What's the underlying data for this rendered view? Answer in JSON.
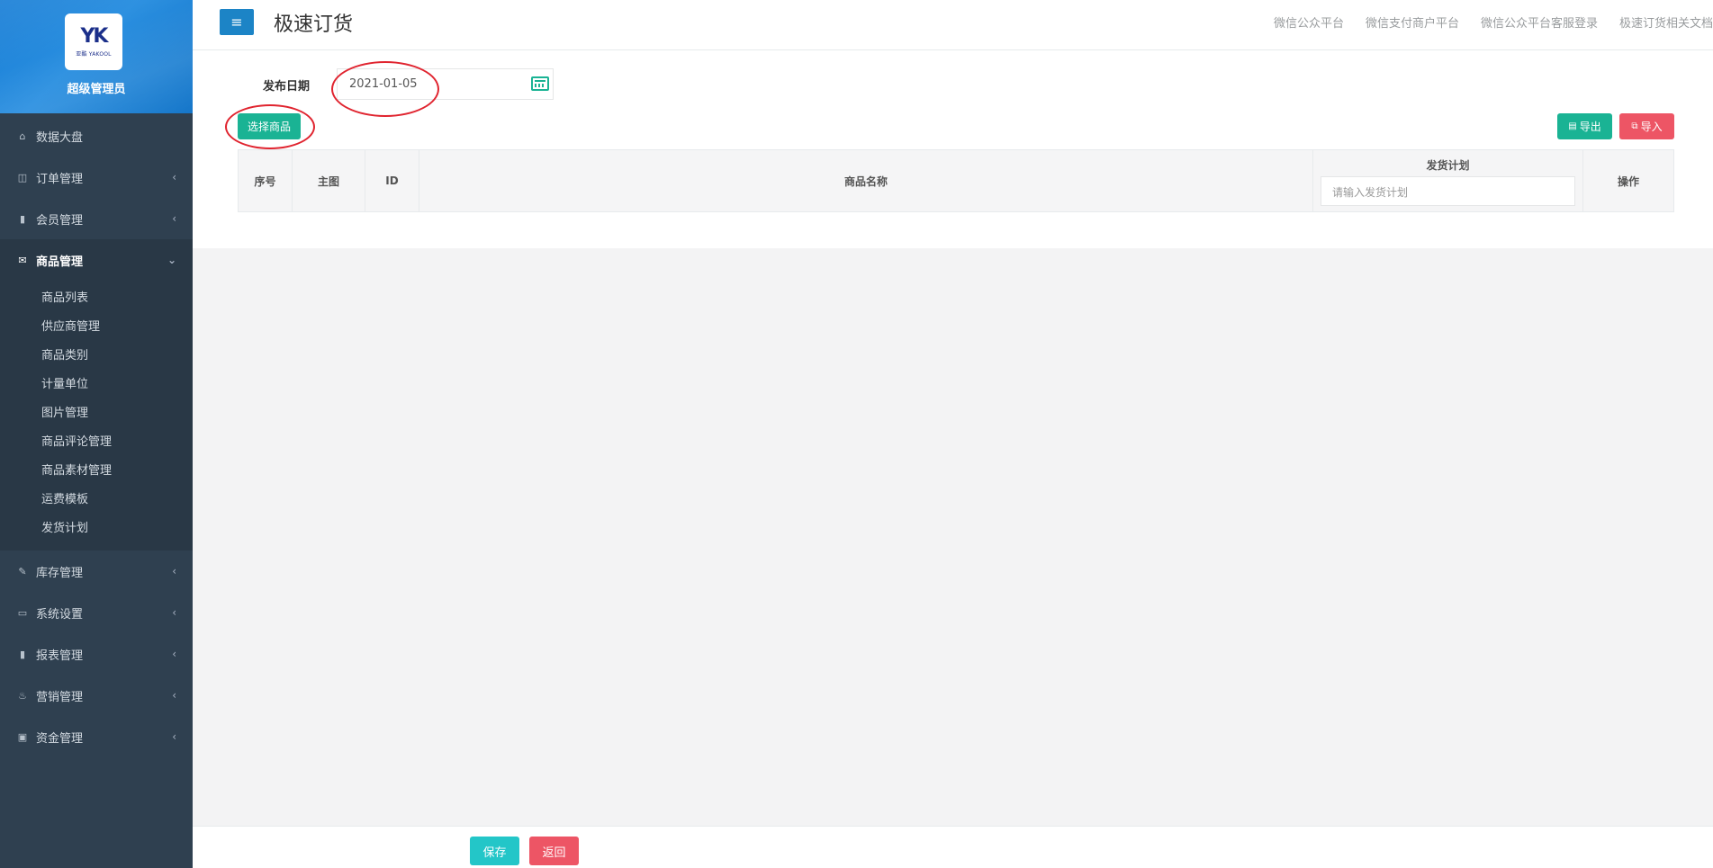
{
  "profile": {
    "logo_mark": "YK",
    "logo_sub": "亚酷 YAKOOL",
    "name": "超级管理员"
  },
  "sidebar": {
    "items": [
      {
        "label": "数据大盘",
        "icon": "home-icon"
      },
      {
        "label": "订单管理",
        "icon": "columns-icon"
      },
      {
        "label": "会员管理",
        "icon": "bar-chart-icon"
      },
      {
        "label": "商品管理",
        "icon": "envelope-icon",
        "active": true
      },
      {
        "label": "库存管理",
        "icon": "edit-icon"
      },
      {
        "label": "系统设置",
        "icon": "desktop-icon"
      },
      {
        "label": "报表管理",
        "icon": "bar-chart-icon"
      },
      {
        "label": "营销管理",
        "icon": "cutlery-icon"
      },
      {
        "label": "资金管理",
        "icon": "money-icon"
      }
    ],
    "sub_items": [
      "商品列表",
      "供应商管理",
      "商品类别",
      "计量单位",
      "图片管理",
      "商品评论管理",
      "商品素材管理",
      "运费模板",
      "发货计划"
    ]
  },
  "header": {
    "menu_icon": "≡",
    "title": "极速订货",
    "links": [
      "微信公众平台",
      "微信支付商户平台",
      "微信公众平台客服登录",
      "极速订货相关文档"
    ]
  },
  "form": {
    "date_label": "发布日期",
    "date_value": "2021-01-05",
    "select_goods_label": "选择商品",
    "export_label": "导出",
    "import_label": "导入"
  },
  "table": {
    "headers": {
      "index": "序号",
      "image": "主图",
      "id": "ID",
      "name": "商品名称",
      "plan": "发货计划",
      "action": "操作"
    },
    "plan_placeholder": "请输入发货计划"
  },
  "footer": {
    "save_label": "保存",
    "back_label": "返回"
  },
  "colors": {
    "sidebar": "#2f4050",
    "primary": "#1ab394",
    "danger": "#ed5565",
    "info": "#23c6c8",
    "header_btn": "#1c84c6",
    "annotation": "#e0242f"
  }
}
